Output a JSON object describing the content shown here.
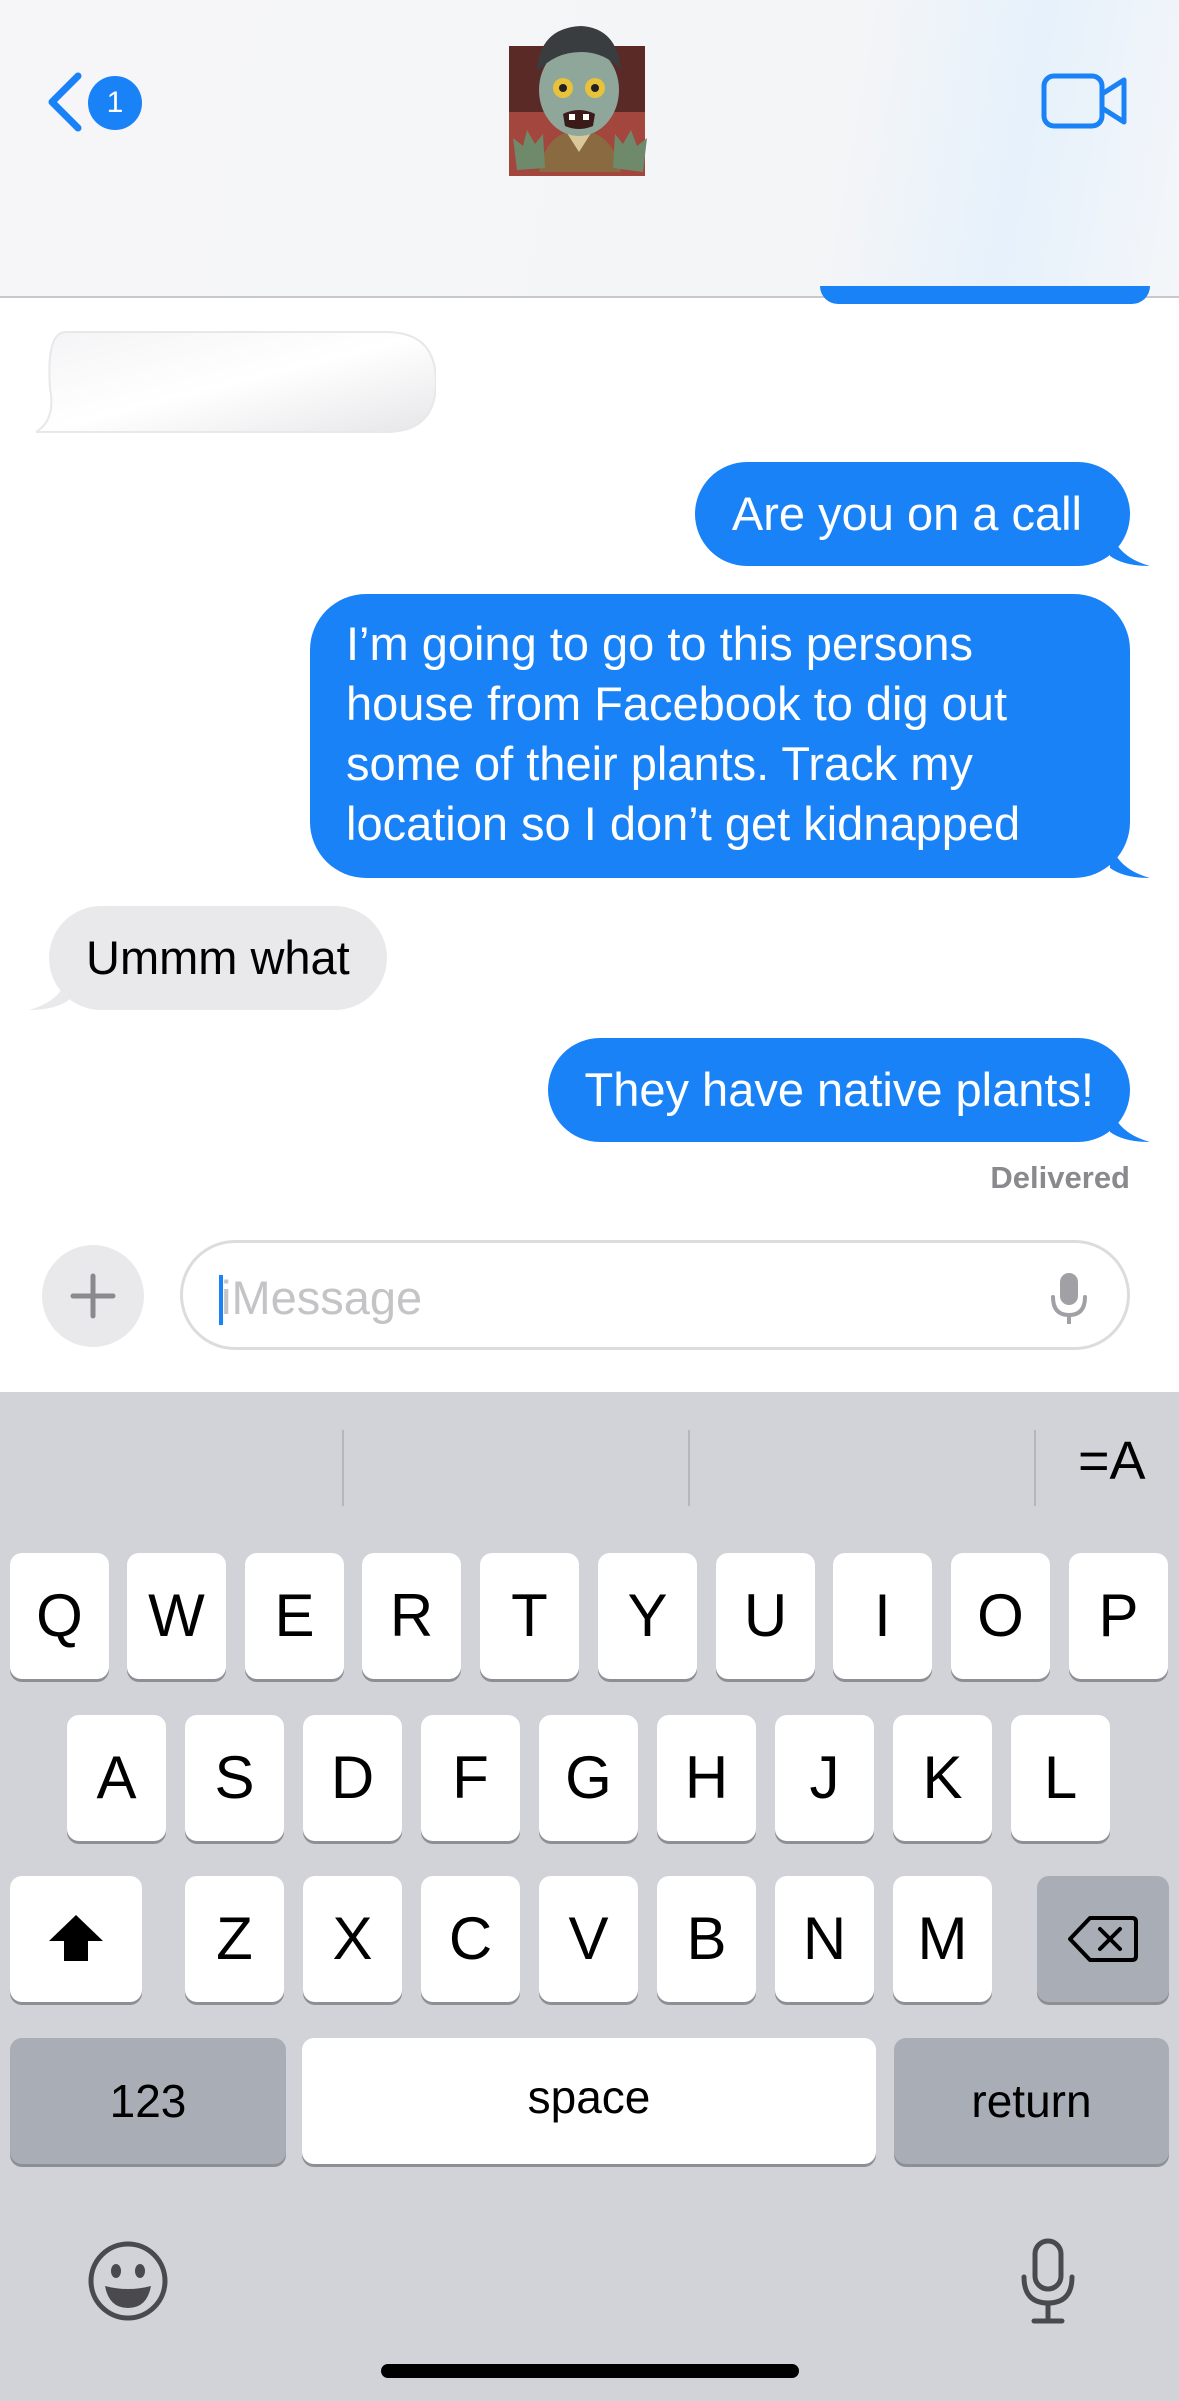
{
  "header": {
    "unread_count": "1",
    "back_icon": "chevron-left-icon",
    "video_icon": "video-camera-icon",
    "avatar": "zombie-memoji"
  },
  "messages": [
    {
      "sender": "other",
      "text": ""
    },
    {
      "sender": "me",
      "text": "Are you on a call"
    },
    {
      "sender": "me",
      "lines": [
        "I’m going to go to this persons",
        "house from Facebook to dig out",
        "some of their plants. Track my",
        "location so I don’t get kidnapped"
      ]
    },
    {
      "sender": "other",
      "text": "Ummm what"
    },
    {
      "sender": "me",
      "text": "They have native plants!"
    }
  ],
  "status": "Delivered",
  "compose": {
    "placeholder": "iMessage",
    "plus_label": "+"
  },
  "keyboard": {
    "format_label": "=A",
    "row1": [
      "Q",
      "W",
      "E",
      "R",
      "T",
      "Y",
      "U",
      "I",
      "O",
      "P"
    ],
    "row2": [
      "A",
      "S",
      "D",
      "F",
      "G",
      "H",
      "J",
      "K",
      "L"
    ],
    "row3": [
      "Z",
      "X",
      "C",
      "V",
      "B",
      "N",
      "M"
    ],
    "numbers_label": "123",
    "space_label": "space",
    "return_label": "return"
  },
  "colors": {
    "accent": "#1a82f7",
    "incoming_bubble": "#e9e9eb",
    "keyboard_bg": "#d1d3d9"
  }
}
